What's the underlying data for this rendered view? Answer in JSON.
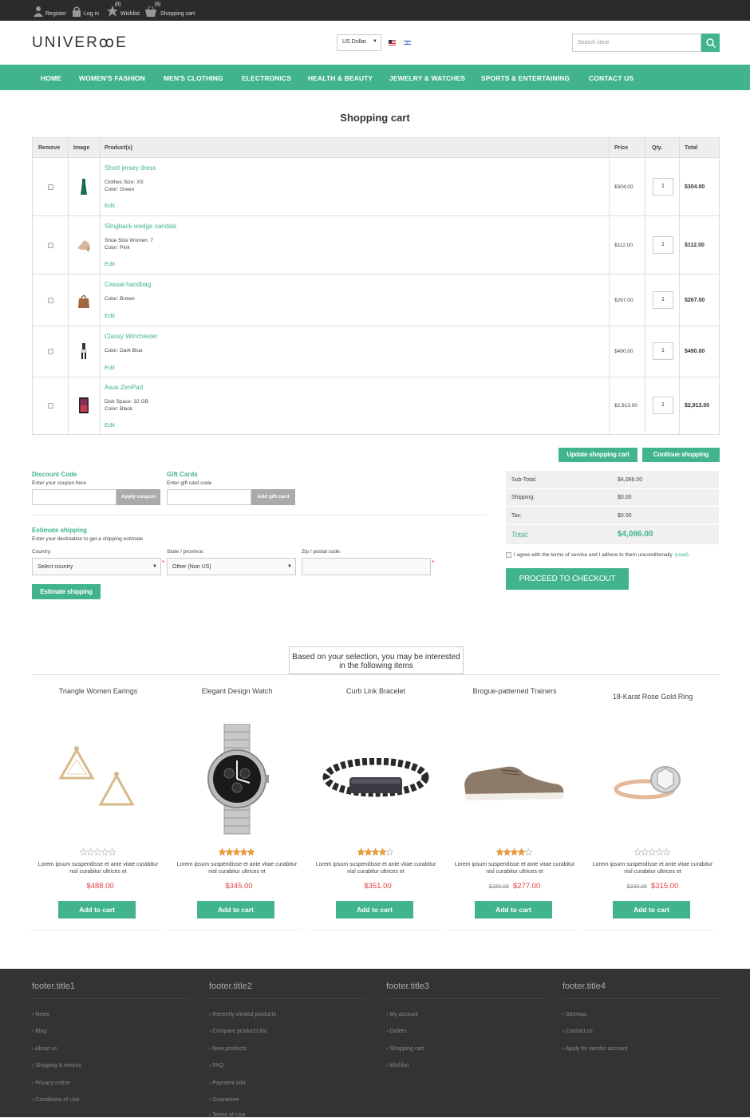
{
  "topbar": {
    "register": "Register",
    "login": "Log in",
    "wishlist": "Wishlist",
    "wishlist_count": "(0)",
    "cart": "Shopping cart",
    "cart_count": "(5)"
  },
  "header": {
    "logo": "UNIVERꝏE",
    "currency": "US Dollar",
    "search_placeholder": "Search store"
  },
  "nav": [
    "HOME",
    "WOMEN'S FASHION",
    "MEN'S CLOTHING",
    "ELECTRONICS",
    "HEALTH & BEAUTY",
    "JEWELRY & WATCHES",
    "SPORTS & ENTERTAINING",
    "CONTACT US"
  ],
  "page_title": "Shopping cart",
  "cart": {
    "headers": {
      "remove": "Remove",
      "image": "Image",
      "product": "Product(s)",
      "price": "Price",
      "qty": "Qty.",
      "total": "Total"
    },
    "items": [
      {
        "name": "Short jersey dress",
        "attrs": [
          "Clothes Size: XS",
          "Color: Green"
        ],
        "edit": "Edit",
        "price": "$304.00",
        "qty": "1",
        "total": "$304.00",
        "icon": "dress-icon"
      },
      {
        "name": "Slingback wedge sandals",
        "attrs": [
          "Shoe Size Women: 7",
          "Color: Pink"
        ],
        "edit": "Edit",
        "price": "$112.00",
        "qty": "1",
        "total": "$112.00",
        "icon": "sandal-icon"
      },
      {
        "name": "Casual handbag",
        "attrs": [
          "Color: Brown"
        ],
        "edit": "Edit",
        "price": "$267.00",
        "qty": "1",
        "total": "$267.00",
        "icon": "handbag-icon"
      },
      {
        "name": "Classy Winchester",
        "attrs": [
          "Color: Dark Blue"
        ],
        "edit": "Edit",
        "price": "$490.00",
        "qty": "1",
        "total": "$490.00",
        "icon": "outfit-icon"
      },
      {
        "name": "Asus ZenPad",
        "attrs": [
          "Disk Space: 32 GB",
          "Color: Black"
        ],
        "edit": "Edit",
        "price": "$2,913.00",
        "qty": "1",
        "total": "$2,913.00",
        "icon": "tablet-icon"
      }
    ],
    "update_btn": "Update shopping cart",
    "continue_btn": "Continue shopping"
  },
  "discount": {
    "title": "Discount Code",
    "hint": "Enter your coupon here",
    "button": "Apply coupon"
  },
  "giftcard": {
    "title": "Gift Cards",
    "hint": "Enter gift card code",
    "button": "Add gift card"
  },
  "shipping": {
    "title": "Estimate shipping",
    "hint": "Enter your destination to get a shipping estimate",
    "country_label": "Country:",
    "country_value": "Select country",
    "state_label": "State / province:",
    "state_value": "Other (Non US)",
    "zip_label": "Zip / postal code:",
    "button": "Estimate shipping"
  },
  "totals": {
    "subtotal_label": "Sub-Total:",
    "subtotal": "$4,086.00",
    "shipping_label": "Shipping:",
    "shipping": "$0.00",
    "tax_label": "Tax:",
    "tax": "$0.00",
    "total_label": "Total:",
    "total": "$4,086.00"
  },
  "terms": {
    "text": "I agree with the terms of service and I adhere to them unconditionally",
    "link": "(read)"
  },
  "checkout_btn": "PROCEED TO CHECKOUT",
  "recommend_title": "Based on your selection, you may be interested in the following items",
  "products": [
    {
      "name": "Triangle Women Earings",
      "desc": "Lorem ipsum suspendisse et ante vitae curabitur nisl curabitur ultrices et",
      "old_price": "",
      "price": "$488.00",
      "rating": 0,
      "button": "Add to cart",
      "image": "earrings-image"
    },
    {
      "name": "Elegant Design Watch",
      "desc": "Lorem ipsum suspendisse et ante vitae curabitur nisl curabitur ultrices et",
      "old_price": "",
      "price": "$345.00",
      "rating": 5,
      "button": "Add to cart",
      "image": "watch-image"
    },
    {
      "name": "Curb Link Bracelet",
      "desc": "Lorem ipsum suspendisse et ante vitae curabitur nisl curabitur ultrices et",
      "old_price": "",
      "price": "$351.00",
      "rating": 4,
      "button": "Add to cart",
      "image": "bracelet-image"
    },
    {
      "name": "Brogue-patterned Trainers",
      "desc": "Lorem ipsum suspendisse et ante vitae curabitur nisl curabitur ultrices et",
      "old_price": "$280.00",
      "price": "$277.00",
      "rating": 4,
      "button": "Add to cart",
      "image": "shoe-image"
    },
    {
      "name": "18-Karat Rose Gold Ring",
      "desc": "Lorem ipsum suspendisse et ante vitae curabitur nisl curabitur ultrices et",
      "old_price": "$330.00",
      "price": "$315.00",
      "rating": 0,
      "button": "Add to cart",
      "image": "ring-image"
    }
  ],
  "footer": [
    {
      "title": "footer.title1",
      "links": [
        "News",
        "Blog",
        "About us",
        "Shipping & returns",
        "Privacy notice",
        "Conditions of Use"
      ]
    },
    {
      "title": "footer.title2",
      "links": [
        "Recently viewed products",
        "Compare products list",
        "New products",
        "FAQ",
        "Payment Info",
        "Guarantee",
        "Terms of Use"
      ]
    },
    {
      "title": "footer.title3",
      "links": [
        "My account",
        "Orders",
        "Shopping cart",
        "Wishlist"
      ]
    },
    {
      "title": "footer.title4",
      "links": [
        "Sitemap",
        "Contact us",
        "Apply for vendor account"
      ]
    }
  ],
  "colors": {
    "accent": "#41b48e",
    "topbar": "#2b2b2b",
    "footer": "#333333",
    "price": "#e04040"
  }
}
